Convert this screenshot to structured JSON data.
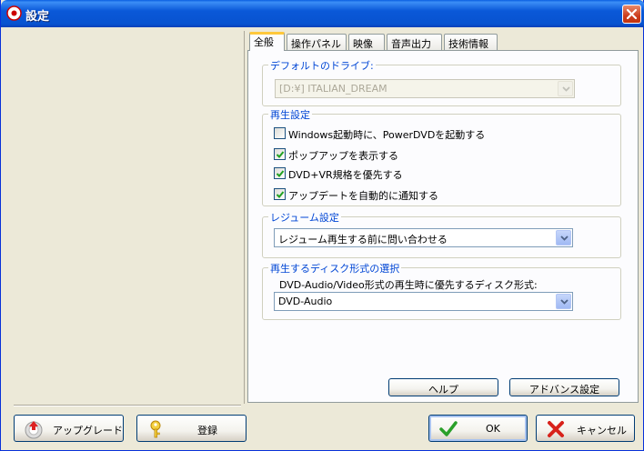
{
  "window": {
    "title": "設定"
  },
  "tabs": [
    "全般",
    "操作パネル",
    "映像",
    "音声出力",
    "技術情報"
  ],
  "drive_group": {
    "title": "デフォルトのドライブ:",
    "selected": "[D:¥] ITALIAN_DREAM"
  },
  "playback_group": {
    "title": "再生設定",
    "options": [
      {
        "label": "Windows起動時に、PowerDVDを起動する",
        "checked": false
      },
      {
        "label": "ポップアップを表示する",
        "checked": true
      },
      {
        "label": "DVD+VR規格を優先する",
        "checked": true
      },
      {
        "label": "アップデートを自動的に通知する",
        "checked": true
      }
    ]
  },
  "resume_group": {
    "title": "レジューム設定",
    "selected": "レジューム再生する前に問い合わせる"
  },
  "disc_group": {
    "title": "再生するディスク形式の選択",
    "description": "DVD-Audio/Video形式の再生時に優先するディスク形式:",
    "selected": "DVD-Audio"
  },
  "buttons": {
    "help": "ヘルプ",
    "advanced": "アドバンス設定",
    "upgrade": "アップグレード",
    "register": "登録",
    "ok": "OK",
    "cancel": "キャンセル"
  },
  "colors": {
    "title_bar": "#0a58d8",
    "group_title": "#0046d5",
    "tab_highlight": "#ffc83c"
  }
}
